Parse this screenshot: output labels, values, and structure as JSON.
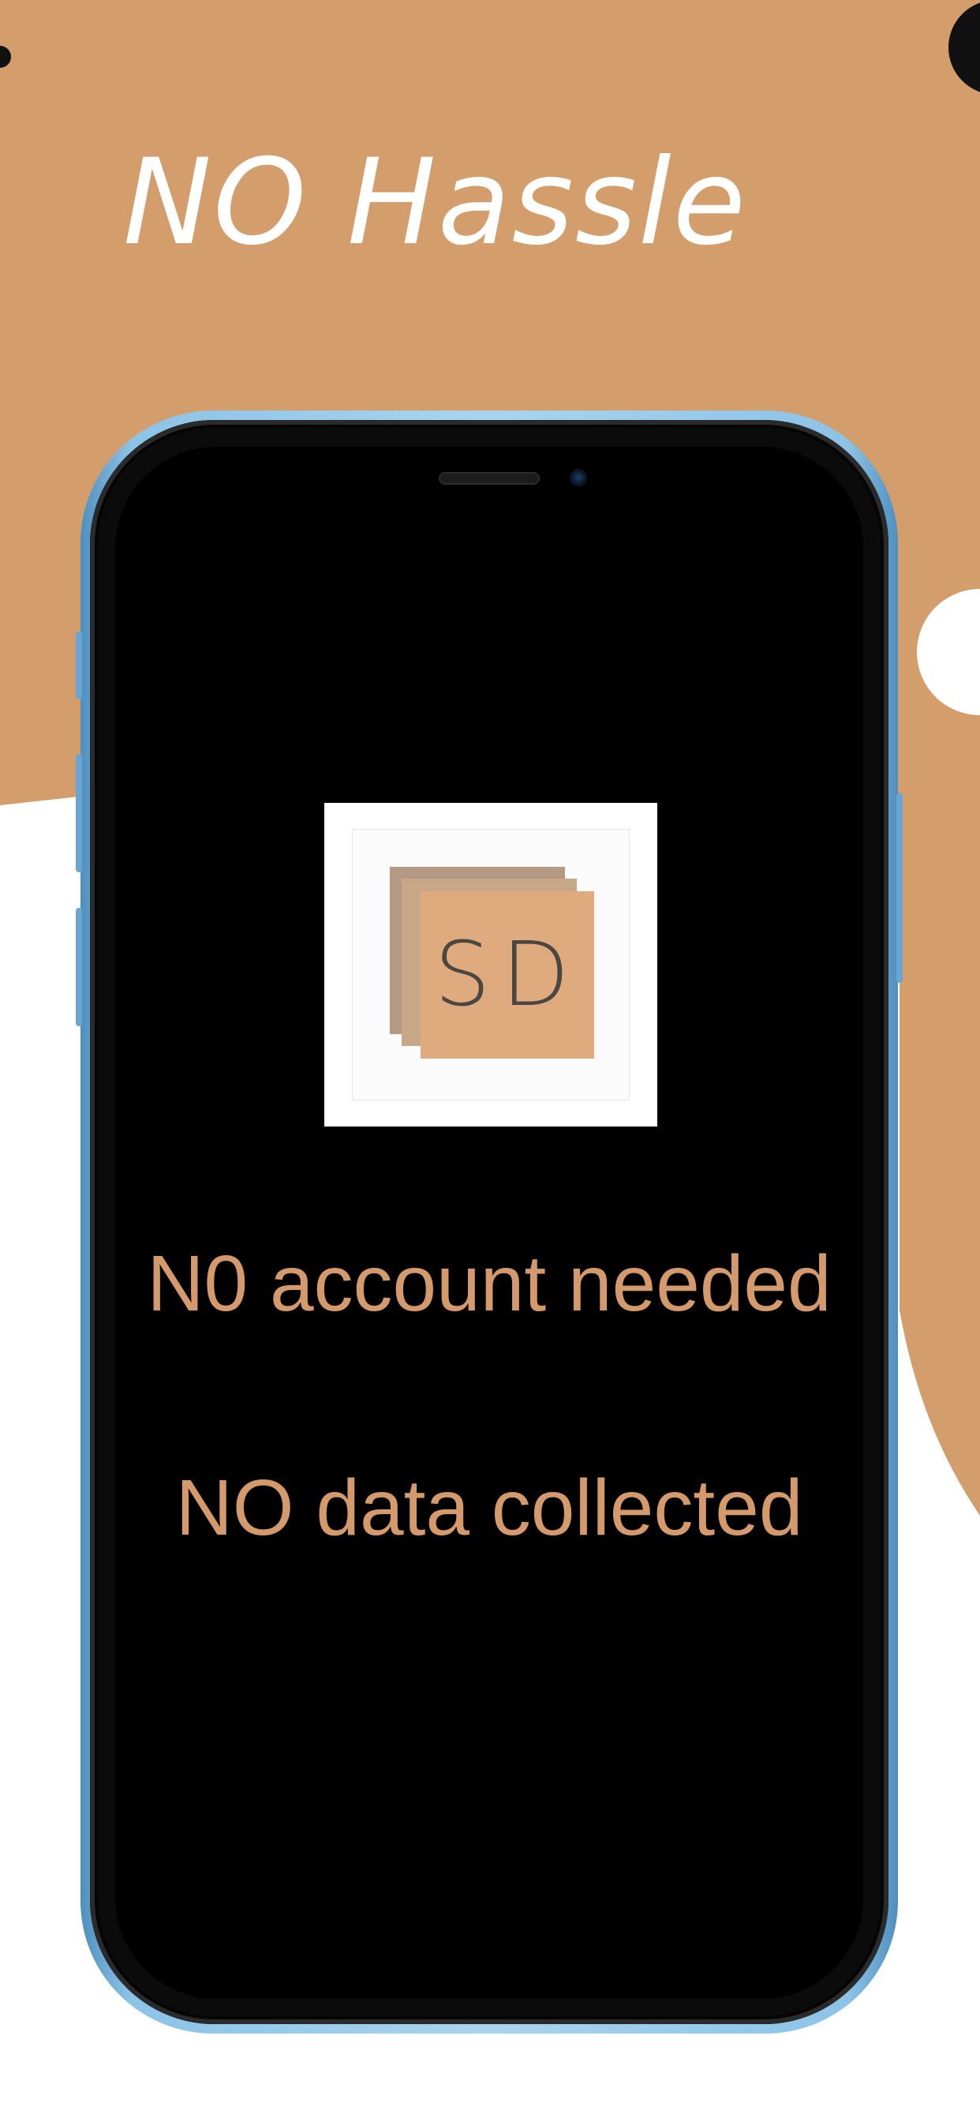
{
  "headline": "NO Hassle",
  "logo": {
    "text": "SD"
  },
  "lines": {
    "account": "N0 account needed",
    "data": "NO data collected"
  },
  "colors": {
    "background_accent": "#d49d6c",
    "background_base": "#ffffff",
    "text_accent": "#d49a6b",
    "phone_frame": "#a9d4ef",
    "screen": "#000000"
  }
}
